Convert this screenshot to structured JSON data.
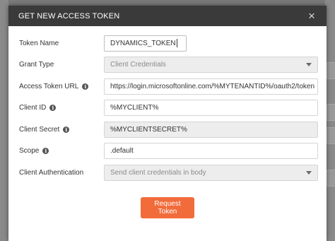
{
  "modal": {
    "title": "GET NEW ACCESS TOKEN",
    "close_symbol": "×"
  },
  "fields": {
    "token_name": {
      "label": "Token Name",
      "value": "DYNAMICS_TOKEN"
    },
    "grant_type": {
      "label": "Grant Type",
      "value": "Client Credentials"
    },
    "access_token_url": {
      "label": "Access Token URL",
      "value": "https://login.microsoftonline.com/%MYTENANTID%/oauth2/token"
    },
    "client_id": {
      "label": "Client ID",
      "value": "%MYCLIENT%"
    },
    "client_secret": {
      "label": "Client Secret",
      "value": "%MYCLIENTSECRET%"
    },
    "scope": {
      "label": "Scope",
      "value": ".default"
    },
    "client_authentication": {
      "label": "Client Authentication",
      "value": "Send client credentials in body"
    }
  },
  "actions": {
    "request_token": "Request Token"
  },
  "icons": {
    "info": "i"
  },
  "colors": {
    "header_bg": "#3a3a3a",
    "accent": "#f26b3a"
  }
}
